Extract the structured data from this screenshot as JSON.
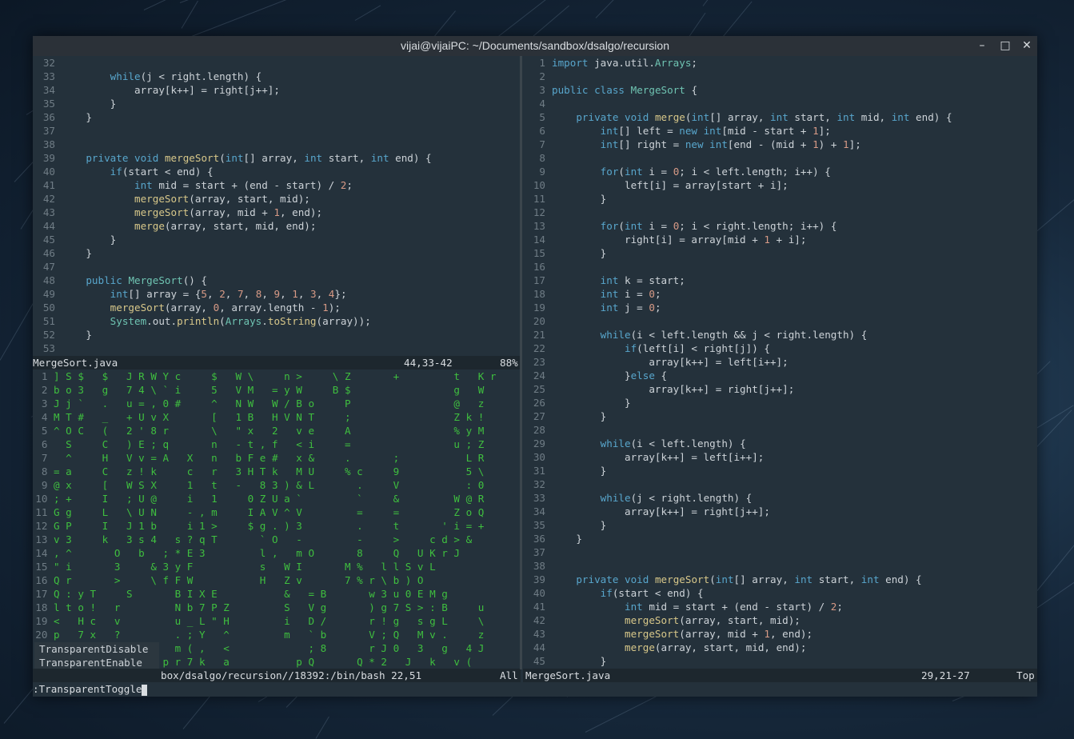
{
  "window": {
    "title": "vijai@vijaiPC: ~/Documents/sandbox/dsalgo/recursion",
    "minimize_icon": "minimize-icon",
    "maximize_icon": "maximize-icon",
    "close_icon": "close-icon"
  },
  "left_pane": {
    "lines": [
      {
        "n": "32",
        "code": ""
      },
      {
        "n": "33",
        "code": "        while(j < right.length) {"
      },
      {
        "n": "34",
        "code": "            array[k++] = right[j++];"
      },
      {
        "n": "35",
        "code": "        }"
      },
      {
        "n": "36",
        "code": "    }"
      },
      {
        "n": "37",
        "code": ""
      },
      {
        "n": "38",
        "code": ""
      },
      {
        "n": "39",
        "code": "    private void mergeSort(int[] array, int start, int end) {"
      },
      {
        "n": "40",
        "code": "        if(start < end) {"
      },
      {
        "n": "41",
        "code": "            int mid = start + (end - start) / 2;"
      },
      {
        "n": "42",
        "code": "            mergeSort(array, start, mid);"
      },
      {
        "n": "43",
        "code": "            mergeSort(array, mid + 1, end);"
      },
      {
        "n": "44",
        "code": "            merge(array, start, mid, end);"
      },
      {
        "n": "45",
        "code": "        }"
      },
      {
        "n": "46",
        "code": "    }"
      },
      {
        "n": "47",
        "code": ""
      },
      {
        "n": "48",
        "code": "    public MergeSort() {"
      },
      {
        "n": "49",
        "code": "        int[] array = {5, 2, 7, 8, 9, 1, 3, 4};"
      },
      {
        "n": "50",
        "code": "        mergeSort(array, 0, array.length - 1);"
      },
      {
        "n": "51",
        "code": "        System.out.println(Arrays.toString(array));"
      },
      {
        "n": "52",
        "code": "    }"
      },
      {
        "n": "53",
        "code": ""
      }
    ],
    "status": {
      "file": "MergeSort.java",
      "pos": "44,33-42",
      "pct": "88%"
    }
  },
  "terminal": {
    "lines": [
      {
        "n": "1",
        "t": "] S $   $   J R W Y c     $   W \\     n >     \\ Z       +         t   K r"
      },
      {
        "n": "2",
        "t": "b o 3   g   7 4 \\ ` i     5   V M   = y W     B $                 g   W"
      },
      {
        "n": "3",
        "t": "J j `   .   u = , 0 #     ^   N W   W / B o     P                 @   z"
      },
      {
        "n": "4",
        "t": "M T #   _   + U v X       [   1 B   H V N T     ;                 Z k !"
      },
      {
        "n": "5",
        "t": "^ O C   (   2 ' 8 r       \\   \" x   2   v e     A                 % y M"
      },
      {
        "n": "6",
        "t": "  S     C   ) E ; q       n   - t , f   < i     =                 u ; Z"
      },
      {
        "n": "7",
        "t": "  ^     H   V v = A   X   n   b F e #   x &     .       ;           L R"
      },
      {
        "n": "8",
        "t": "= a     C   z ! k     c   r   3 H T k   M U     % c     9           5 \\"
      },
      {
        "n": "9",
        "t": "@ x     [   W S X     1   t   -   8 3 ) & L       .     V           : 0"
      },
      {
        "n": "10",
        "t": "; +     I   ; U @     i   1     0 Z U a `         `     &         W @ R"
      },
      {
        "n": "11",
        "t": "G g     L   \\ U N     - , m     I A V ^ V         =     =         Z o Q"
      },
      {
        "n": "12",
        "t": "G P     I   J 1 b     i 1 >     $ g . ) 3         .     t       ' i = +"
      },
      {
        "n": "13",
        "t": "v 3     k   3 s 4   s ? q T       ` O   -         -     >     c d > &"
      },
      {
        "n": "14",
        "t": ", ^       O   b   ; * E 3         l ,   m O       8     Q   U K r J"
      },
      {
        "n": "15",
        "t": "\" i       3     & 3 y F           s   W I       M %   l l S v L"
      },
      {
        "n": "16",
        "t": "Q r       >     \\ f F W           H   Z v       7 % r \\ b ) O"
      },
      {
        "n": "17",
        "t": "Q : y T     S       B I X E           &   = B       w 3 u 0 E M g"
      },
      {
        "n": "18",
        "t": "l t o !   r         N b 7 P Z         S   V g       ) g 7 S > : B     u"
      },
      {
        "n": "19",
        "t": "<   H c   v         u _ L \" H         i   D /       r ! g   s g L     \\"
      },
      {
        "n": "20",
        "t": "p   7 x   ?         . ; Y   ^         m   ` b       V ; Q   M v .     z"
      },
      {
        "n": "21",
        "t": "                    m ( ,   <             ; 8       r J 0   3   g   4 J"
      },
      {
        "n": "22",
        "t": "                  p r 7 k   a           p Q       Q * 2   J   k   v ("
      }
    ],
    "status": {
      "text": "box/dsalgo/recursion//18392:/bin/bash 22,51",
      "pos": "All"
    }
  },
  "popup": {
    "items": [
      {
        "label": "TransparentDisable"
      },
      {
        "label": "TransparentEnable"
      },
      {
        "label": "TransparentToggle"
      }
    ]
  },
  "right_pane": {
    "lines": [
      {
        "n": "1",
        "code": "import java.util.Arrays;"
      },
      {
        "n": "2",
        "code": ""
      },
      {
        "n": "3",
        "code": "public class MergeSort {"
      },
      {
        "n": "4",
        "code": ""
      },
      {
        "n": "5",
        "code": "    private void merge(int[] array, int start, int mid, int end) {"
      },
      {
        "n": "6",
        "code": "        int[] left = new int[mid - start + 1];"
      },
      {
        "n": "7",
        "code": "        int[] right = new int[end - (mid + 1) + 1];"
      },
      {
        "n": "8",
        "code": ""
      },
      {
        "n": "9",
        "code": "        for(int i = 0; i < left.length; i++) {"
      },
      {
        "n": "10",
        "code": "            left[i] = array[start + i];"
      },
      {
        "n": "11",
        "code": "        }"
      },
      {
        "n": "12",
        "code": ""
      },
      {
        "n": "13",
        "code": "        for(int i = 0; i < right.length; i++) {"
      },
      {
        "n": "14",
        "code": "            right[i] = array[mid + 1 + i];"
      },
      {
        "n": "15",
        "code": "        }"
      },
      {
        "n": "16",
        "code": ""
      },
      {
        "n": "17",
        "code": "        int k = start;"
      },
      {
        "n": "18",
        "code": "        int i = 0;"
      },
      {
        "n": "19",
        "code": "        int j = 0;"
      },
      {
        "n": "20",
        "code": ""
      },
      {
        "n": "21",
        "code": "        while(i < left.length && j < right.length) {"
      },
      {
        "n": "22",
        "code": "            if(left[i] < right[j]) {"
      },
      {
        "n": "23",
        "code": "                array[k++] = left[i++];"
      },
      {
        "n": "24",
        "code": "            }else {"
      },
      {
        "n": "25",
        "code": "                array[k++] = right[j++];"
      },
      {
        "n": "26",
        "code": "            }"
      },
      {
        "n": "27",
        "code": "        }"
      },
      {
        "n": "28",
        "code": ""
      },
      {
        "n": "29",
        "code": "        while(i < left.length) {"
      },
      {
        "n": "30",
        "code": "            array[k++] = left[i++];"
      },
      {
        "n": "31",
        "code": "        }"
      },
      {
        "n": "32",
        "code": ""
      },
      {
        "n": "33",
        "code": "        while(j < right.length) {"
      },
      {
        "n": "34",
        "code": "            array[k++] = right[j++];"
      },
      {
        "n": "35",
        "code": "        }"
      },
      {
        "n": "36",
        "code": "    }"
      },
      {
        "n": "37",
        "code": ""
      },
      {
        "n": "38",
        "code": ""
      },
      {
        "n": "39",
        "code": "    private void mergeSort(int[] array, int start, int end) {"
      },
      {
        "n": "40",
        "code": "        if(start < end) {"
      },
      {
        "n": "41",
        "code": "            int mid = start + (end - start) / 2;"
      },
      {
        "n": "42",
        "code": "            mergeSort(array, start, mid);"
      },
      {
        "n": "43",
        "code": "            mergeSort(array, mid + 1, end);"
      },
      {
        "n": "44",
        "code": "            merge(array, start, mid, end);"
      },
      {
        "n": "45",
        "code": "        }"
      }
    ],
    "status": {
      "file": "MergeSort.java",
      "pos": "29,21-27",
      "pct": "Top"
    }
  },
  "cmdline": {
    "text": ":TransparentToggle"
  },
  "colors": {
    "keyword": "#58a6cc",
    "function": "#d8c88a",
    "class": "#6fc4b2",
    "number": "#d79a86",
    "matrix": "#3fbf3f"
  }
}
